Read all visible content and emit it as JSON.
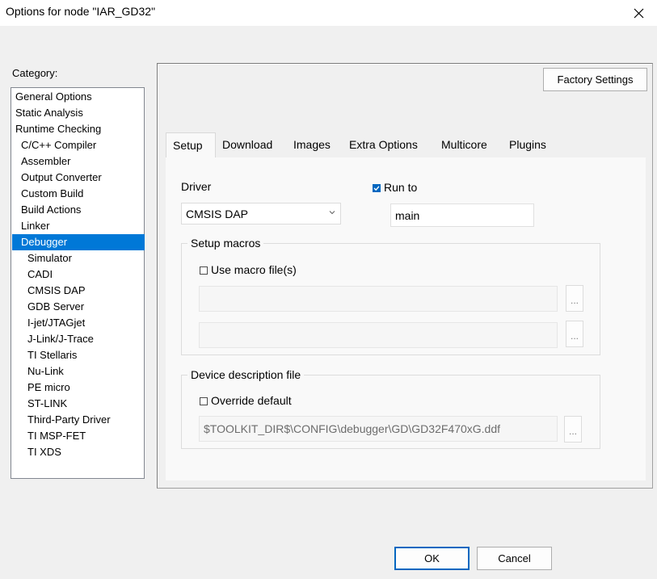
{
  "window": {
    "title": "Options for node \"IAR_GD32\"",
    "close_icon": "close-icon"
  },
  "category": {
    "label": "Category:",
    "items": [
      {
        "label": "General Options",
        "indent": 0
      },
      {
        "label": "Static Analysis",
        "indent": 0
      },
      {
        "label": "Runtime Checking",
        "indent": 0
      },
      {
        "label": "C/C++ Compiler",
        "indent": 1
      },
      {
        "label": "Assembler",
        "indent": 1
      },
      {
        "label": "Output Converter",
        "indent": 1
      },
      {
        "label": "Custom Build",
        "indent": 1
      },
      {
        "label": "Build Actions",
        "indent": 1
      },
      {
        "label": "Linker",
        "indent": 1
      },
      {
        "label": "Debugger",
        "indent": 1,
        "selected": true
      },
      {
        "label": "Simulator",
        "indent": 2
      },
      {
        "label": "CADI",
        "indent": 2
      },
      {
        "label": "CMSIS DAP",
        "indent": 2
      },
      {
        "label": "GDB Server",
        "indent": 2
      },
      {
        "label": "I-jet/JTAGjet",
        "indent": 2
      },
      {
        "label": "J-Link/J-Trace",
        "indent": 2
      },
      {
        "label": "TI Stellaris",
        "indent": 2
      },
      {
        "label": "Nu-Link",
        "indent": 2
      },
      {
        "label": "PE micro",
        "indent": 2
      },
      {
        "label": "ST-LINK",
        "indent": 2
      },
      {
        "label": "Third-Party Driver",
        "indent": 2
      },
      {
        "label": "TI MSP-FET",
        "indent": 2
      },
      {
        "label": "TI XDS",
        "indent": 2
      }
    ]
  },
  "factory_settings_label": "Factory Settings",
  "tabs": [
    {
      "label": "Setup",
      "active": true
    },
    {
      "label": "Download"
    },
    {
      "label": "Images"
    },
    {
      "label": "Extra Options"
    },
    {
      "label": "Multicore"
    },
    {
      "label": "Plugins"
    }
  ],
  "setup": {
    "driver_label": "Driver",
    "driver_value": "CMSIS DAP",
    "run_to_label": "Run to",
    "run_to_checked": true,
    "run_to_value": "main",
    "macros_group_label": "Setup macros",
    "use_macro_label": "Use macro file(s)",
    "use_macro_checked": false,
    "macro_file_1": "",
    "macro_file_2": "",
    "browse_label": "...",
    "device_group_label": "Device description file",
    "override_label": "Override default",
    "override_checked": false,
    "device_file_value": "$TOOLKIT_DIR$\\CONFIG\\debugger\\GD\\GD32F470xG.ddf"
  },
  "buttons": {
    "ok": "OK",
    "cancel": "Cancel"
  },
  "colors": {
    "selection": "#0078d7",
    "checkbox_checked": "#0067c0"
  }
}
